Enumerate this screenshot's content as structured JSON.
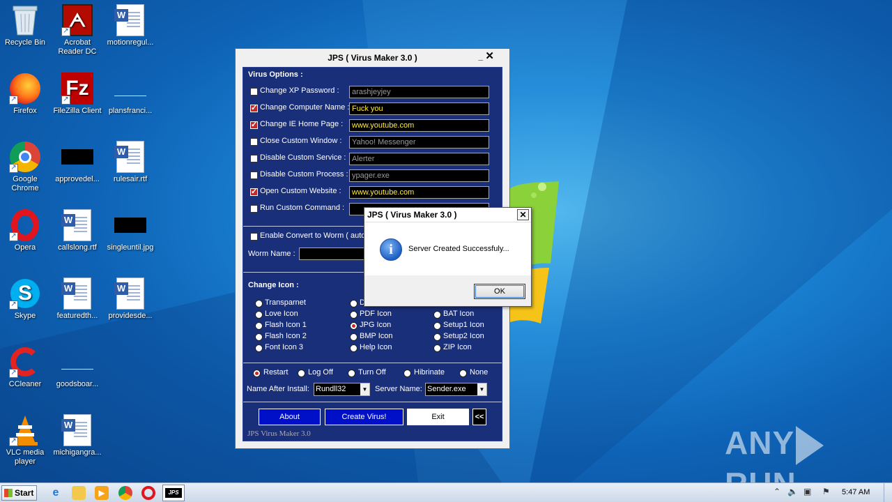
{
  "desktop": {
    "icons": [
      {
        "label": "Recycle Bin"
      },
      {
        "label": "Acrobat Reader DC"
      },
      {
        "label": "motionregul..."
      },
      {
        "label": "Firefox"
      },
      {
        "label": "FileZilla Client"
      },
      {
        "label": "plansfranci..."
      },
      {
        "label": "Google Chrome"
      },
      {
        "label": "approvedel..."
      },
      {
        "label": "rulesair.rtf"
      },
      {
        "label": "Opera"
      },
      {
        "label": "callslong.rtf"
      },
      {
        "label": "singleuntil.jpg"
      },
      {
        "label": "Skype"
      },
      {
        "label": "featuredth..."
      },
      {
        "label": "providesde..."
      },
      {
        "label": "CCleaner"
      },
      {
        "label": "goodsboar..."
      },
      {
        "label": "VLC media player"
      },
      {
        "label": "michigangra..."
      }
    ]
  },
  "jps_window": {
    "title": "JPS ( Virus Maker 3.0 )",
    "minimize_glyph": "_",
    "close_glyph": "✕",
    "virus_options_heading": "Virus Options :",
    "options": [
      {
        "label": "Change XP Password :",
        "checked": false,
        "value": "arashjeyjey"
      },
      {
        "label": "Change Computer Name :",
        "checked": true,
        "value": "Fuck you"
      },
      {
        "label": "Change IE Home Page :",
        "checked": true,
        "value": "www.youtube.com"
      },
      {
        "label": "Close Custom Window :",
        "checked": false,
        "value": "Yahoo! Messenger"
      },
      {
        "label": "Disable Custom Service :",
        "checked": false,
        "value": "Alerter"
      },
      {
        "label": "Disable Custom Process :",
        "checked": false,
        "value": "ypager.exe"
      },
      {
        "label": "Open Custom Website :",
        "checked": true,
        "value": "www.youtube.com"
      },
      {
        "label": "Run Custom Command :",
        "checked": false,
        "value": ""
      }
    ],
    "worm_checkbox_label": "Enable Convert to Worm ( auto",
    "worm_name_label": "Worm Name :",
    "worm_name_value": "",
    "change_icon_heading": "Change Icon :",
    "icon_options": [
      {
        "label": "Transparnet",
        "selected": false
      },
      {
        "label": "D",
        "selected": false
      },
      {
        "label": "Love Icon",
        "selected": false
      },
      {
        "label": "PDF Icon",
        "selected": false
      },
      {
        "label": "BAT Icon",
        "selected": false
      },
      {
        "label": "Flash Icon 1",
        "selected": false
      },
      {
        "label": "JPG Icon",
        "selected": true
      },
      {
        "label": "Setup1 Icon",
        "selected": false
      },
      {
        "label": "Flash Icon 2",
        "selected": false
      },
      {
        "label": "BMP Icon",
        "selected": false
      },
      {
        "label": "Setup2 Icon",
        "selected": false
      },
      {
        "label": "Font Icon 3",
        "selected": false
      },
      {
        "label": "Help Icon",
        "selected": false
      },
      {
        "label": "ZIP Icon",
        "selected": false
      }
    ],
    "power_options": [
      {
        "label": "Restart",
        "selected": true
      },
      {
        "label": "Log Off",
        "selected": false
      },
      {
        "label": "Turn Off",
        "selected": false
      },
      {
        "label": "Hibrinate",
        "selected": false
      },
      {
        "label": "None",
        "selected": false
      }
    ],
    "name_after_install_label": "Name After Install:",
    "name_after_install_value": "Rundll32",
    "server_name_label": "Server Name:",
    "server_name_value": "Sender.exe",
    "buttons": {
      "about": "About",
      "create": "Create Virus!",
      "exit": "Exit",
      "collapse": "<<"
    },
    "footer_brand": "JPS Virus Maker 3.0"
  },
  "dialog": {
    "title": "JPS ( Virus Maker 3.0 )",
    "close_glyph": "✕",
    "icon_glyph": "i",
    "message": "Server Created Successfuly...",
    "ok_label": "OK"
  },
  "taskbar": {
    "start_label": "Start",
    "clock": "5:47 AM"
  },
  "watermark": {
    "left": "ANY",
    "right": "RUN"
  },
  "colors": {
    "jps_panel": "#1a2f7a",
    "create_button": "#0010c8",
    "checked_box": "#c62828",
    "active_text": "#ffeb3b"
  }
}
